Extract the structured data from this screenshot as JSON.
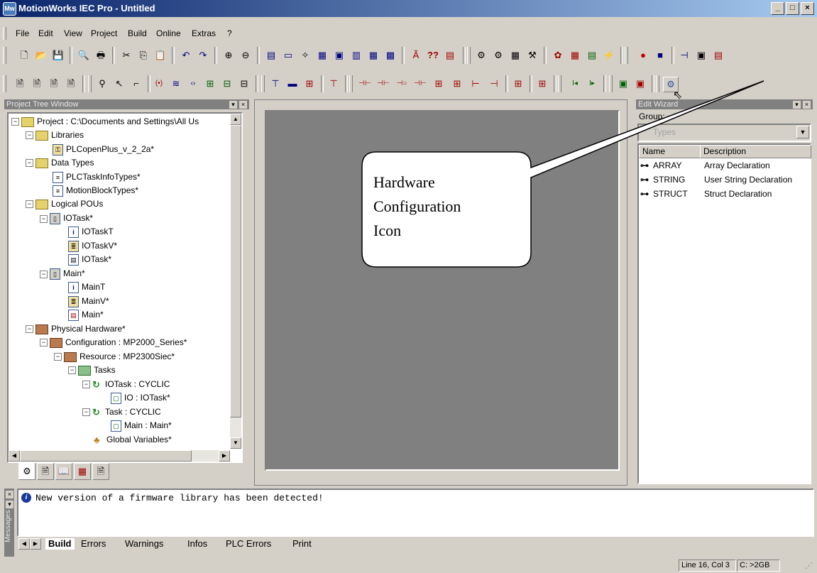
{
  "window": {
    "title": "MotionWorks IEC Pro - Untitled",
    "app_icon": "Mw"
  },
  "menu": [
    "File",
    "Edit",
    "View",
    "Project",
    "Build",
    "Online",
    "Extras",
    "?"
  ],
  "project_tree": {
    "header": "Project Tree Window",
    "items": [
      "Project : C:\\Documents and Settings\\All Us",
      "Libraries",
      "PLCopenPlus_v_2_2a*",
      "Data Types",
      "PLCTaskInfoTypes*",
      "MotionBlockTypes*",
      "Logical POUs",
      "IOTask*",
      "IOTaskT",
      "IOTaskV*",
      "IOTask*",
      "Main*",
      "MainT",
      "MainV*",
      "Main*",
      "Physical Hardware*",
      "Configuration : MP2000_Series*",
      "Resource : MP2300Siec*",
      "Tasks",
      "IOTask : CYCLIC",
      "IO : IOTask*",
      "Task : CYCLIC",
      "Main : Main*",
      "Global Variables*"
    ]
  },
  "edit_wizard": {
    "header": "Edit Wizard",
    "group_label": "Group:",
    "group_value": "Types",
    "col_name": "Name",
    "col_description": "Description",
    "rows": [
      {
        "name": "ARRAY",
        "description": "Array Declaration"
      },
      {
        "name": "STRING",
        "description": "User String Declaration"
      },
      {
        "name": "STRUCT",
        "description": "Struct Declaration"
      }
    ]
  },
  "callout": {
    "line1": "Hardware",
    "line2": "Configuration",
    "line3": "Icon"
  },
  "messages": {
    "side_label": "Messages",
    "text": "New version of a firmware library has been detected!",
    "tabs": [
      "Build",
      "Errors",
      "Warnings",
      "Infos",
      "PLC Errors",
      "Print"
    ]
  },
  "status": {
    "position": "Line 16, Col 3",
    "disk": "C: >2GB"
  },
  "colors": {
    "title_start": "#0a246a",
    "title_end": "#a6caf0",
    "workspace": "#808080",
    "panel_head": "#808080"
  }
}
